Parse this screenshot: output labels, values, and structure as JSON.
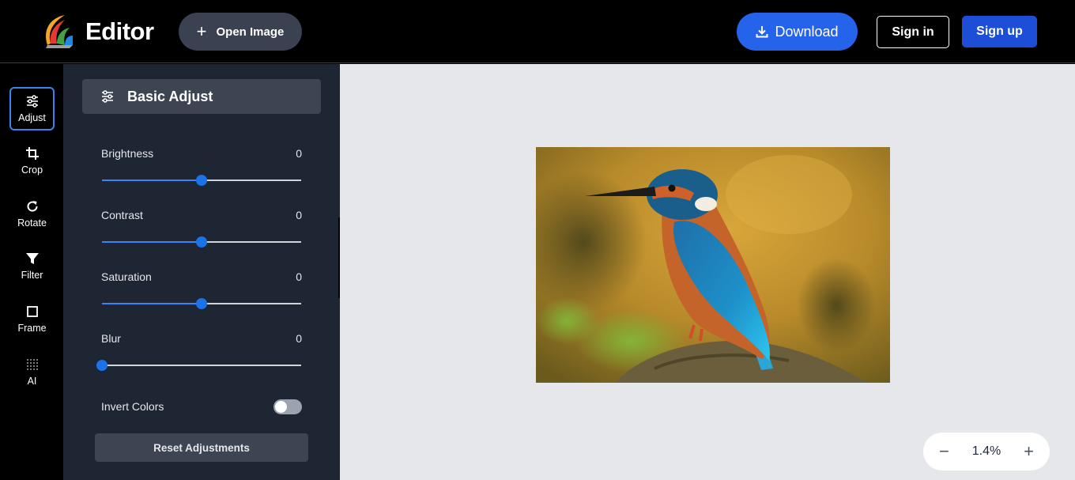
{
  "header": {
    "app_title": "Editor",
    "open_image_label": "Open Image",
    "download_label": "Download",
    "signin_label": "Sign in",
    "signup_label": "Sign up"
  },
  "tools": [
    {
      "label": "Adjust",
      "icon": "sliders-icon",
      "active": true
    },
    {
      "label": "Crop",
      "icon": "crop-icon",
      "active": false
    },
    {
      "label": "Rotate",
      "icon": "rotate-icon",
      "active": false
    },
    {
      "label": "Filter",
      "icon": "filter-icon",
      "active": false
    },
    {
      "label": "Frame",
      "icon": "frame-icon",
      "active": false
    },
    {
      "label": "AI",
      "icon": "dots-grid-icon",
      "active": false
    }
  ],
  "panel": {
    "title": "Basic Adjust",
    "sliders": [
      {
        "label": "Brightness",
        "value": "0",
        "position": 0.5
      },
      {
        "label": "Contrast",
        "value": "0",
        "position": 0.5
      },
      {
        "label": "Saturation",
        "value": "0",
        "position": 0.5
      },
      {
        "label": "Blur",
        "value": "0",
        "position": 0.0
      }
    ],
    "invert_label": "Invert Colors",
    "invert_on": false,
    "reset_label": "Reset Adjustments"
  },
  "zoom": {
    "value": "1.4%",
    "minus": "−",
    "plus": "+"
  },
  "colors": {
    "accent": "#2563eb",
    "panel_bg": "#1e2533",
    "canvas_bg": "#e5e7eb"
  }
}
